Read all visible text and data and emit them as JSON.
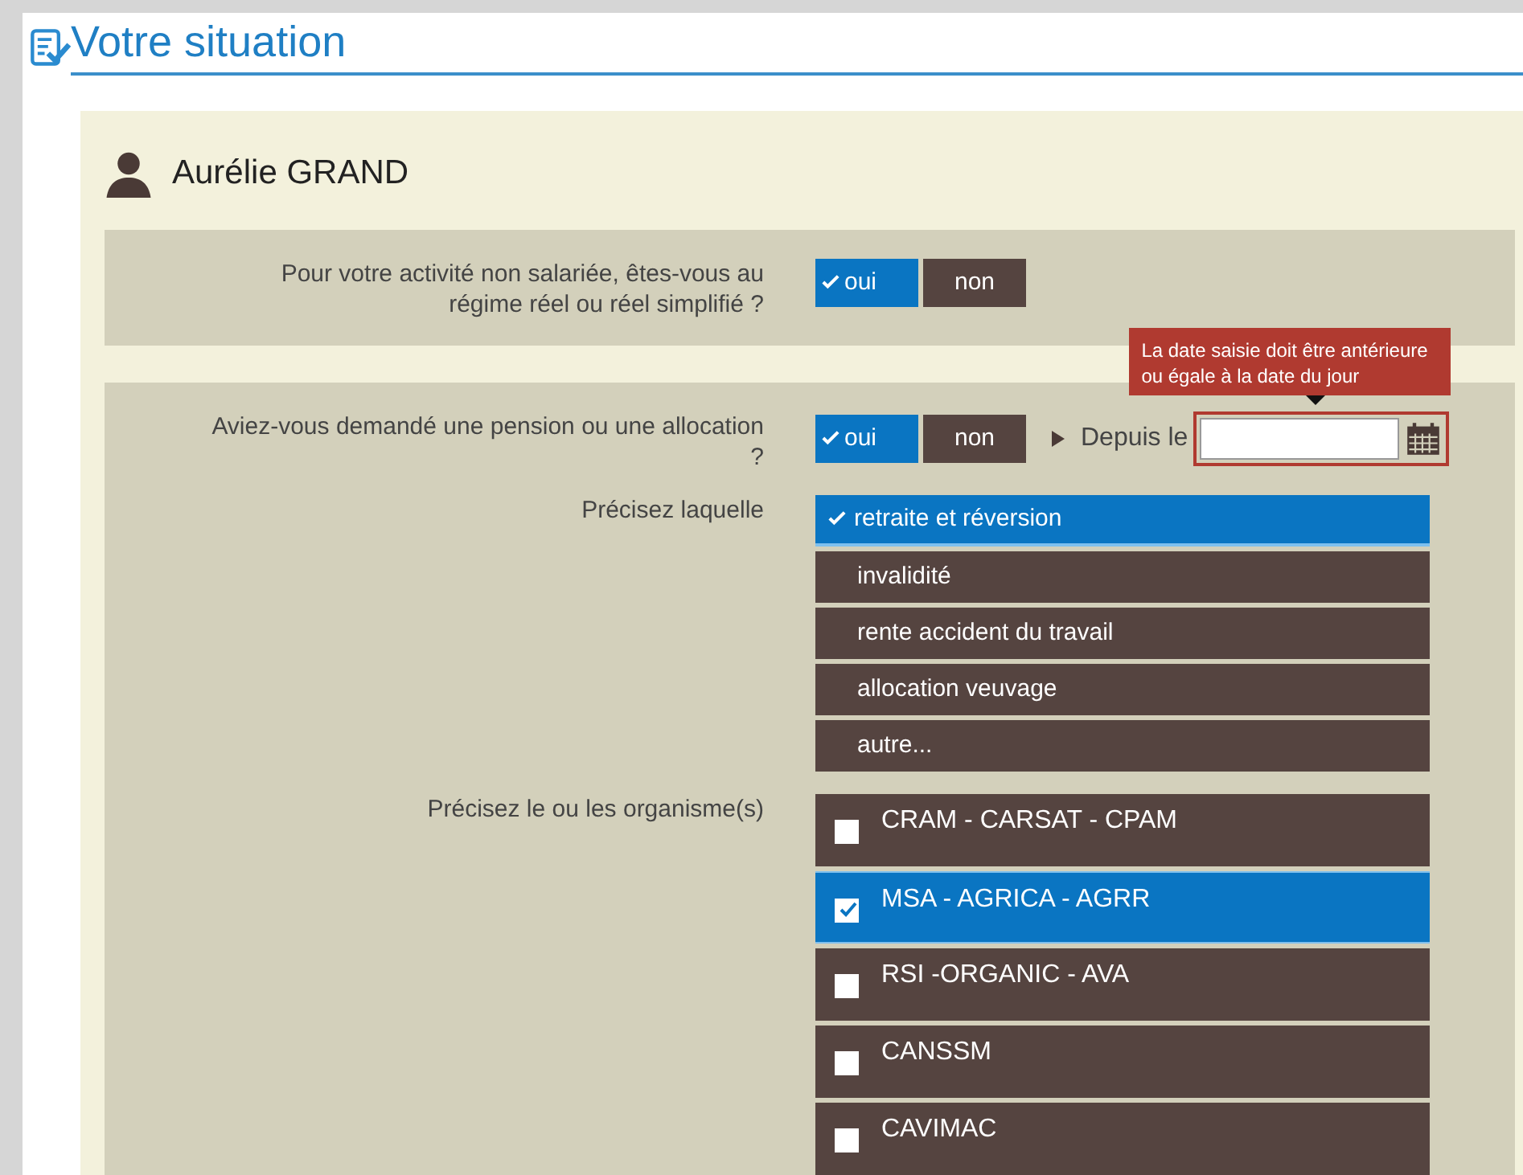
{
  "page": {
    "title": "Votre situation"
  },
  "person": {
    "name": "Aurélie GRAND"
  },
  "sections": [
    {
      "questions": [
        {
          "kind": "toggle",
          "label": "Pour votre activité non salariée, êtes-vous au régime réel ou réel simplifié ?",
          "options": [
            {
              "label": "oui",
              "selected": true
            },
            {
              "label": "non",
              "selected": false
            }
          ]
        }
      ]
    },
    {
      "questions": [
        {
          "kind": "toggle",
          "label": "Aviez-vous demandé une pension ou une allocation ?",
          "options": [
            {
              "label": "oui",
              "selected": true
            },
            {
              "label": "non",
              "selected": false
            }
          ],
          "date": {
            "label": "Depuis le",
            "error": "La date saisie doit être antérieure ou égale à la date du jour"
          }
        },
        {
          "kind": "choice",
          "label": "Précisez laquelle",
          "options": [
            {
              "label": "retraite et réversion",
              "selected": true
            },
            {
              "label": "invalidité",
              "selected": false
            },
            {
              "label": "rente accident du travail",
              "selected": false
            },
            {
              "label": "allocation veuvage",
              "selected": false
            },
            {
              "label": "autre...",
              "selected": false
            }
          ]
        },
        {
          "kind": "checklist",
          "label": "Précisez le ou les organisme(s)",
          "options": [
            {
              "label": "CRAM - CARSAT - CPAM",
              "checked": false
            },
            {
              "label": "MSA - AGRICA - AGRR",
              "checked": true
            },
            {
              "label": "RSI -ORGANIC - AVA",
              "checked": false
            },
            {
              "label": "CANSSM",
              "checked": false
            },
            {
              "label": "CAVIMAC",
              "checked": false
            }
          ]
        }
      ]
    }
  ]
}
